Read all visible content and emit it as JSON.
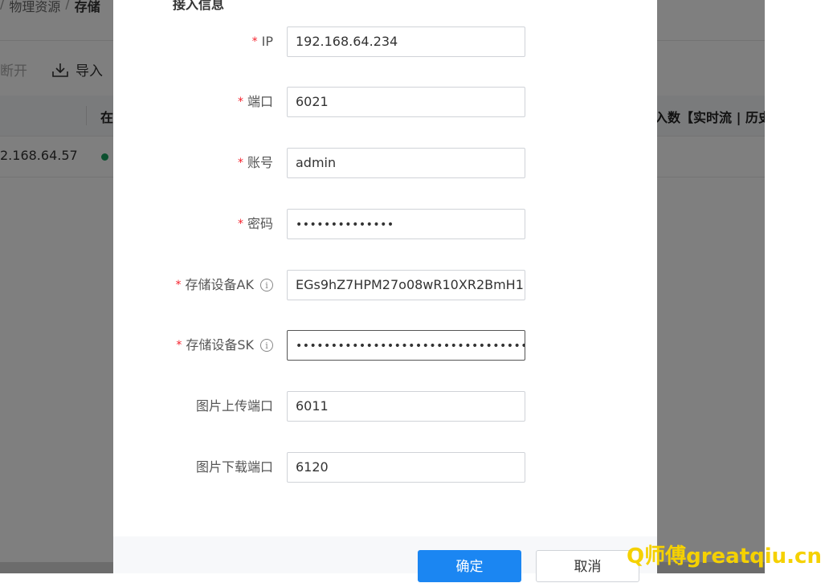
{
  "background_page": {
    "breadcrumb": {
      "separator_prefix": "/",
      "parent": "物理资源",
      "separator": "/",
      "current": "存储"
    },
    "toolbar": {
      "disconnect_label": "断开",
      "import_label": "导入"
    },
    "table": {
      "status_header": "在",
      "count_header": "入数【实时流 | 历史",
      "row": {
        "ip": "2.168.64.57"
      }
    }
  },
  "modal": {
    "section_title": "接入信息",
    "fields": [
      {
        "label": "IP",
        "required": true,
        "value": "192.168.64.234",
        "type": "text"
      },
      {
        "label": "端口",
        "required": true,
        "value": "6021",
        "type": "text"
      },
      {
        "label": "账号",
        "required": true,
        "value": "admin",
        "type": "text"
      },
      {
        "label": "密码",
        "required": true,
        "value": "••••••••••••••",
        "type": "password"
      },
      {
        "label": "存储设备AK",
        "required": true,
        "value": "EGs9hZ7HPM27o08wR10XR2BmH1",
        "type": "text",
        "info": true
      },
      {
        "label": "存储设备SK",
        "required": true,
        "value": "••••••••••••••••••••••••••••••••••••••",
        "type": "password",
        "info": true,
        "focused": true
      },
      {
        "label": "图片上传端口",
        "required": false,
        "value": "6011",
        "type": "text"
      },
      {
        "label": "图片下载端口",
        "required": false,
        "value": "6120",
        "type": "text"
      }
    ],
    "required_mark": "*",
    "info_glyph": "i",
    "confirm_label": "确定",
    "cancel_label": "取消"
  },
  "watermark": "Q师傅greatqiu.cn",
  "colors": {
    "primary": "#1b86f2",
    "required": "#f5222d",
    "online_dot": "#19a15f",
    "watermark": "#f5d100"
  }
}
